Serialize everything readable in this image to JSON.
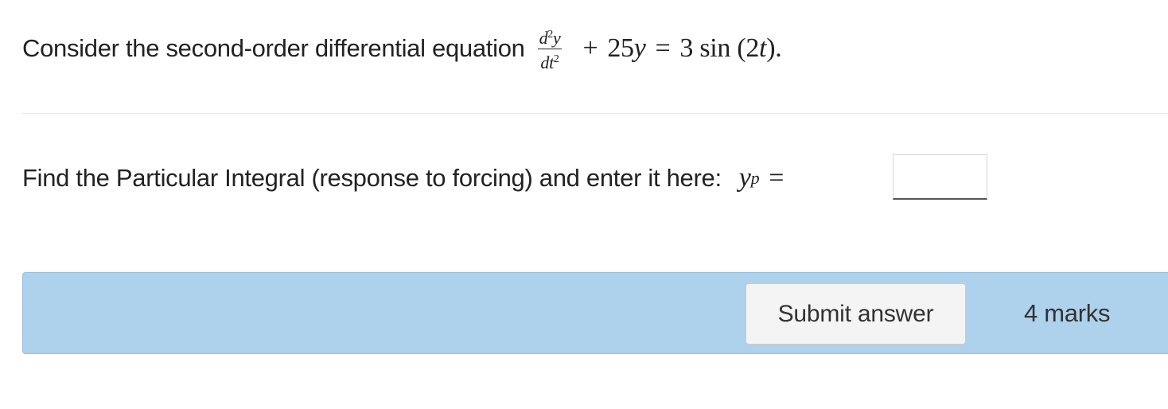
{
  "question": {
    "intro": "Consider the second-order differential equation",
    "equation": {
      "fraction_numerator_d": "d",
      "fraction_numerator_exp": "2",
      "fraction_numerator_var": "y",
      "fraction_denominator_dt": "dt",
      "fraction_denominator_exp": "2",
      "plus": "+",
      "term": "25",
      "term_var": "y",
      "equals": "=",
      "rhs_coef": "3",
      "rhs_func": "sin",
      "rhs_arg_open": "(2",
      "rhs_arg_var": "t",
      "rhs_arg_close": ")."
    }
  },
  "part": {
    "prompt": "Find the Particular Integral (response to forcing) and enter it here:",
    "lhs_var": "y",
    "lhs_sub": "p",
    "equals": "=",
    "input_value": ""
  },
  "actions": {
    "submit_label": "Submit answer",
    "marks": "4 marks"
  },
  "colors": {
    "action_bar_bg": "#aed1ec",
    "button_bg": "#f4f4f4"
  }
}
